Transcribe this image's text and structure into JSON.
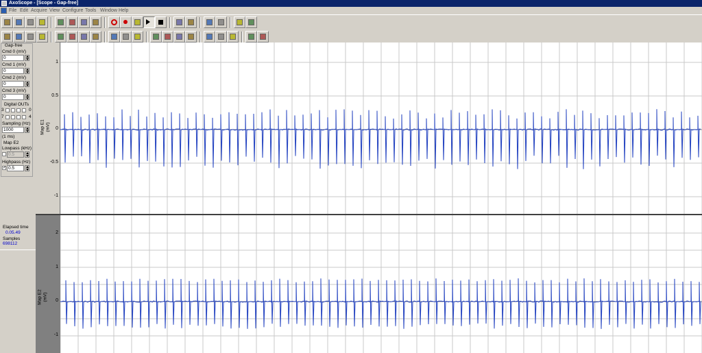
{
  "window": {
    "title": "AxoScope - [Scope - Gap-free]"
  },
  "menu": [
    "File",
    "Edit",
    "Acquire",
    "View",
    "Configure",
    "Tools",
    "Window",
    "Help"
  ],
  "toolbar1_icons": [
    "open-icon",
    "save-icon",
    "save-as-icon",
    "print-setup-icon",
    "protocol-icon",
    "record-setup-icon",
    "statistics-icon",
    "file-info-icon",
    "record-icon",
    "record-dot-icon",
    "step-icon",
    "play-icon",
    "stop-icon",
    "hand-icon",
    "cursor-icon",
    "zoom-in-icon",
    "zoom-out-icon",
    "select-region-icon",
    "fit-icon"
  ],
  "toolbar2_icons": [
    "open-data-icon",
    "save-data-icon",
    "export-icon",
    "copy-icon",
    "lock-icon",
    "list-icon",
    "print-icon",
    "preview-icon",
    "magnify-icon",
    "arrow-icon",
    "flag-icon",
    "scale-icon",
    "undo-icon",
    "redo-icon",
    "marker-icon",
    "edit-icon",
    "window-icon",
    "check-icon",
    "tile-horizontal-icon",
    "tile-vertical-icon"
  ],
  "panel": {
    "mode": "Gap-free",
    "cmd0_label": "Cmd 0 (mV)",
    "cmd0_value": "0",
    "cmd1_label": "Cmd 1 (mV)",
    "cmd1_value": "0",
    "cmd2_label": "Cmd 2 (mV)",
    "cmd2_value": "0",
    "cmd3_label": "Cmd 3 (mV)",
    "cmd3_value": "0",
    "digital_label": "Digital OUTs",
    "digital_row1_left": "3",
    "digital_row1_right": "0",
    "digital_row2_left": "7",
    "digital_row2_right": "4",
    "sampling_label": "Sampling (Hz)",
    "sampling_value": "1000",
    "interval_note": "(1 ms)",
    "signal_label": "Map E2",
    "lowpass_label": "Lowpass (kHz)",
    "lowpass_value": "0.5",
    "highpass_label": "Highpass (Hz)",
    "highpass_value": "0.5",
    "elapsed_label": "Elapsed time",
    "elapsed_value": "0.05.49",
    "samples_label": "Samples",
    "samples_value": "698112"
  },
  "traces": {
    "trace1": {
      "name": "Map E1",
      "unit": "(mV)",
      "ticks": [
        "1",
        "0.5",
        "0",
        "-0.5",
        "-1"
      ],
      "color": "#1f3fbf"
    },
    "trace2": {
      "name": "Map E2",
      "unit": "(mV)",
      "ticks": [
        "2",
        "1",
        "0",
        "-1"
      ],
      "color": "#1f3fbf"
    }
  },
  "colors": {
    "window_bg": "#d4d0c8",
    "trace": "#1f3fbf",
    "grid": "#c8c8c8",
    "title_bar": "#0a246a"
  }
}
